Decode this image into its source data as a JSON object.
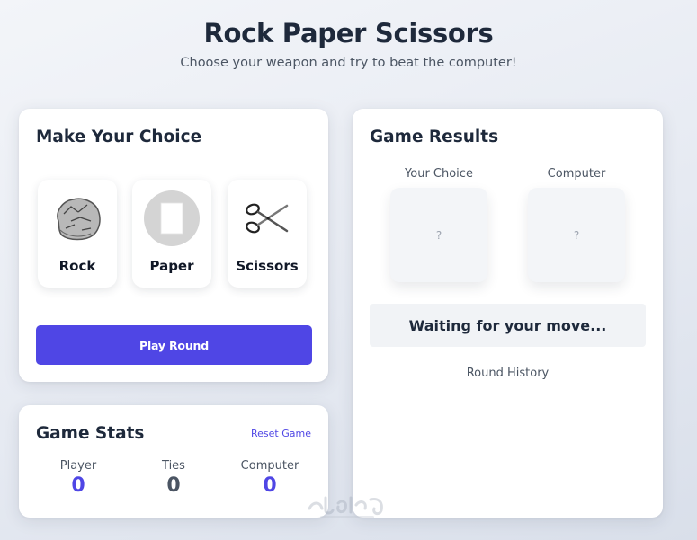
{
  "header": {
    "title": "Rock Paper Scissors",
    "subtitle": "Choose your weapon and try to beat the computer!"
  },
  "choice_panel": {
    "title": "Make Your Choice",
    "weapons": [
      {
        "label": "Rock",
        "icon": "rock-icon"
      },
      {
        "label": "Paper",
        "icon": "paper-icon"
      },
      {
        "label": "Scissors",
        "icon": "scissors-icon"
      }
    ],
    "play_button": "Play Round"
  },
  "results_panel": {
    "title": "Game Results",
    "your_choice_label": "Your Choice",
    "computer_label": "Computer",
    "your_choice_value": "?",
    "computer_value": "?",
    "status": "Waiting for your move...",
    "history_label": "Round History"
  },
  "stats_panel": {
    "title": "Game Stats",
    "reset_label": "Reset Game",
    "stats": [
      {
        "label": "Player",
        "value": "0"
      },
      {
        "label": "Ties",
        "value": "0"
      },
      {
        "label": "Computer",
        "value": "0"
      }
    ]
  },
  "colors": {
    "accent": "#4f46e5",
    "text_dark": "#1e293b",
    "text_muted": "#4b5563"
  }
}
